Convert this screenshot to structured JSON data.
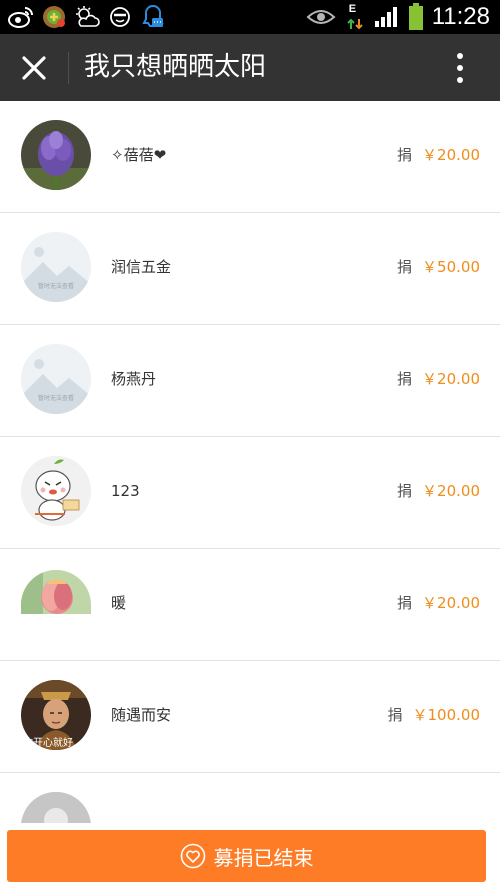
{
  "status_bar": {
    "time": "11:28",
    "network_letter": "E",
    "left_icons": [
      "weibo-icon",
      "game-icon",
      "weather-icon",
      "face-icon",
      "qq-icon"
    ],
    "right_icons": [
      "eye-icon",
      "data-arrows-icon",
      "signal-icon",
      "battery-icon"
    ]
  },
  "title_bar": {
    "title": "我只想晒晒太阳",
    "close_icon": "close-icon",
    "more_icon": "more-vertical-icon"
  },
  "donation_prefix": "捐",
  "donors": [
    {
      "name": "✧蓓蓓❤",
      "amount": "￥20.00",
      "avatar": "purple-flower-photo"
    },
    {
      "name": "润信五金",
      "amount": "￥50.00",
      "avatar": "placeholder-image",
      "avatar_text": "暂时无法查看"
    },
    {
      "name": "杨燕丹",
      "amount": "￥20.00",
      "avatar": "placeholder-image",
      "avatar_text": "暂时无法查看"
    },
    {
      "name": "123",
      "amount": "￥20.00",
      "avatar": "cartoon-character"
    },
    {
      "name": "暖",
      "amount": "￥20.00",
      "avatar": "tulip-painting"
    },
    {
      "name": "随遇而安",
      "amount": "￥100.00",
      "avatar": "portrait-photo",
      "avatar_text": "你开心就好"
    },
    {
      "name": "",
      "amount": "",
      "avatar": "default-avatar"
    }
  ],
  "bottom_button": {
    "label": "募捐已结束",
    "icon": "heart-circle-icon"
  },
  "colors": {
    "accent": "#fe7c26",
    "amount": "#f08c1a",
    "title_bar": "#333333",
    "status_bar": "#000000"
  }
}
